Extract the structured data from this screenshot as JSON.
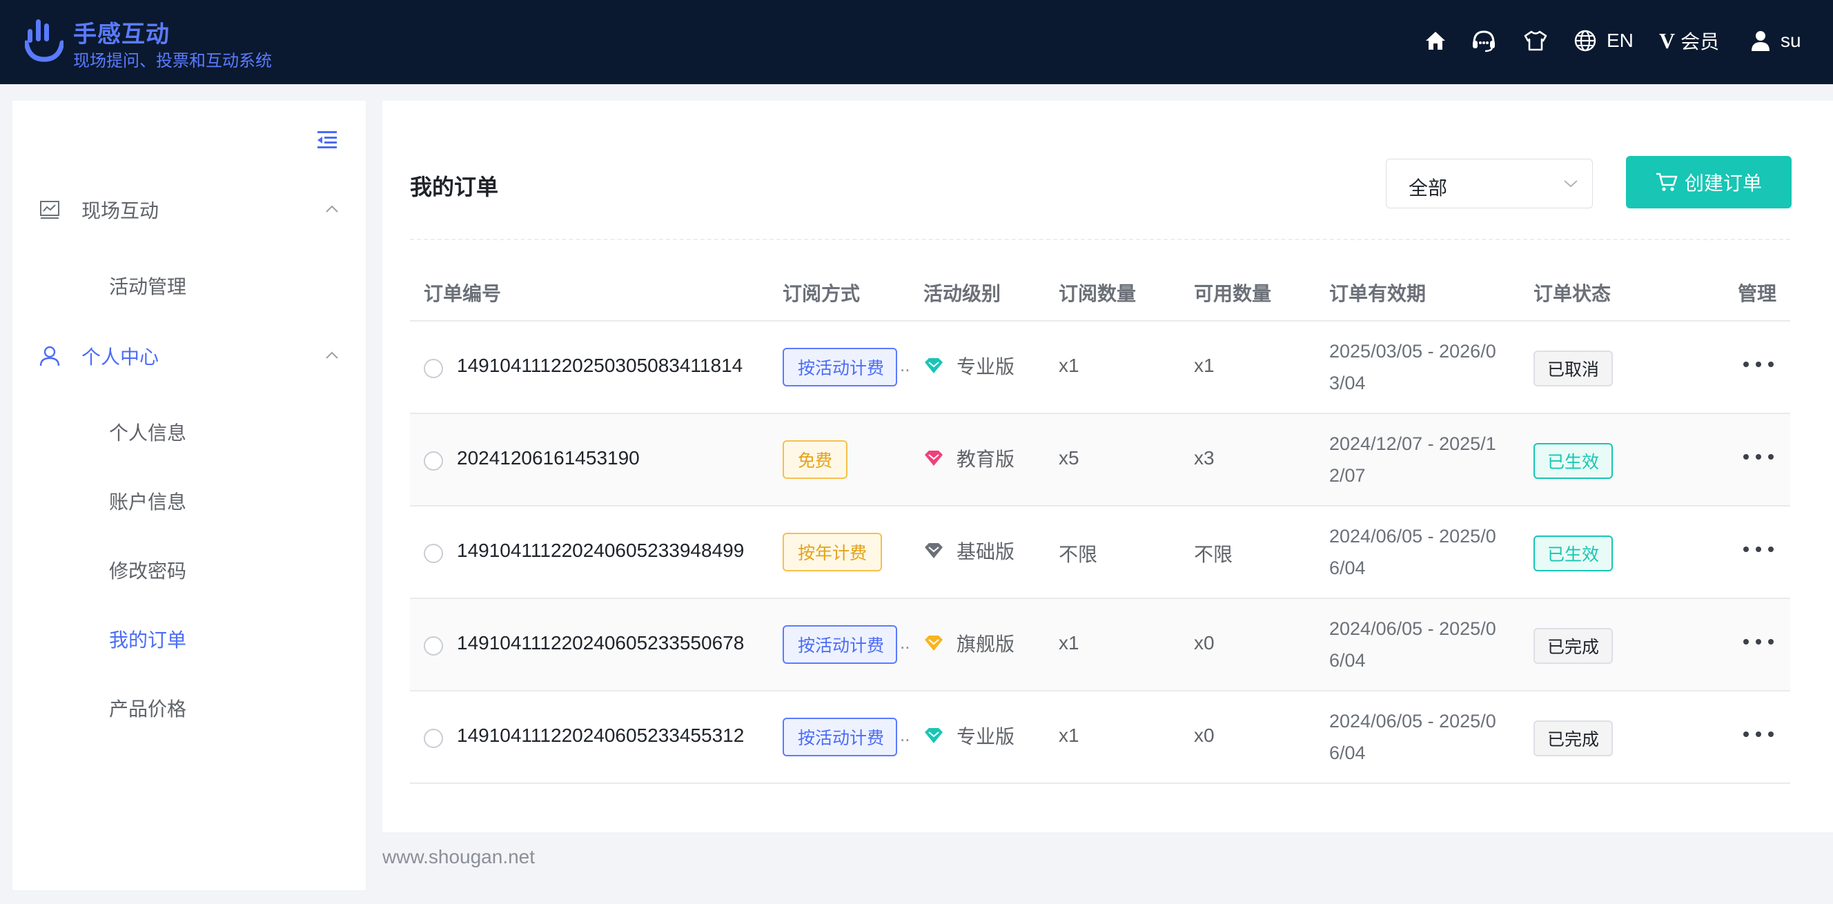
{
  "brand": {
    "title": "手感互动",
    "subtitle": "现场提问、投票和互动系统"
  },
  "topnav": {
    "language": "EN",
    "vip_glyph": "V",
    "vip_label": "会员",
    "user": "su"
  },
  "sidebar": {
    "groups": [
      {
        "label": "现场互动",
        "icon": "chart-icon",
        "items": [
          "活动管理"
        ]
      },
      {
        "label": "个人中心",
        "icon": "user-icon",
        "items": [
          "个人信息",
          "账户信息",
          "修改密码",
          "我的订单",
          "产品价格"
        ]
      }
    ],
    "active_item": "我的订单"
  },
  "main": {
    "title": "我的订单",
    "filter_value": "全部",
    "create_label": "创建订单",
    "columns": [
      "订单编号",
      "订阅方式",
      "活动级别",
      "订阅数量",
      "可用数量",
      "订单有效期",
      "订单状态",
      "管理"
    ],
    "ellipsis": "..",
    "rows": [
      {
        "order_no": "1491041112202503050834118​14",
        "sub": "按活动计费",
        "sub_color": "blue",
        "level": "专业版",
        "level_color": "#17c6b4",
        "qty": "x1",
        "avail": "x1",
        "validity": "2025/03/05 - 2026/03/04",
        "status": "已取消",
        "status_style": "gray"
      },
      {
        "order_no": "20241206161453190",
        "sub": "免费",
        "sub_color": "orange",
        "level": "教育版",
        "level_color": "#f0407a",
        "qty": "x5",
        "avail": "x3",
        "validity": "2024/12/07 - 2025/12/07",
        "status": "已生效",
        "status_style": "green"
      },
      {
        "order_no": "149104111220240605233948499",
        "sub": "按年计费",
        "sub_color": "orange",
        "level": "基础版",
        "level_color": "#6b7078",
        "qty": "不限",
        "avail": "不限",
        "validity": "2024/06/05 - 2025/06/04",
        "status": "已生效",
        "status_style": "green"
      },
      {
        "order_no": "149104111220240605233550678",
        "sub": "按活动计费",
        "sub_color": "blue",
        "level": "旗舰版",
        "level_color": "#f7b51e",
        "qty": "x1",
        "avail": "x0",
        "validity": "2024/06/05 - 2025/06/04",
        "status": "已完成",
        "status_style": "gray"
      },
      {
        "order_no": "149104111220240605233455312",
        "sub": "按活动计费",
        "sub_color": "blue",
        "level": "专业版",
        "level_color": "#17c6b4",
        "qty": "x1",
        "avail": "x0",
        "validity": "2024/06/05 - 2025/06/04",
        "status": "已完成",
        "status_style": "gray"
      }
    ]
  },
  "footer": "www.shougan.net"
}
